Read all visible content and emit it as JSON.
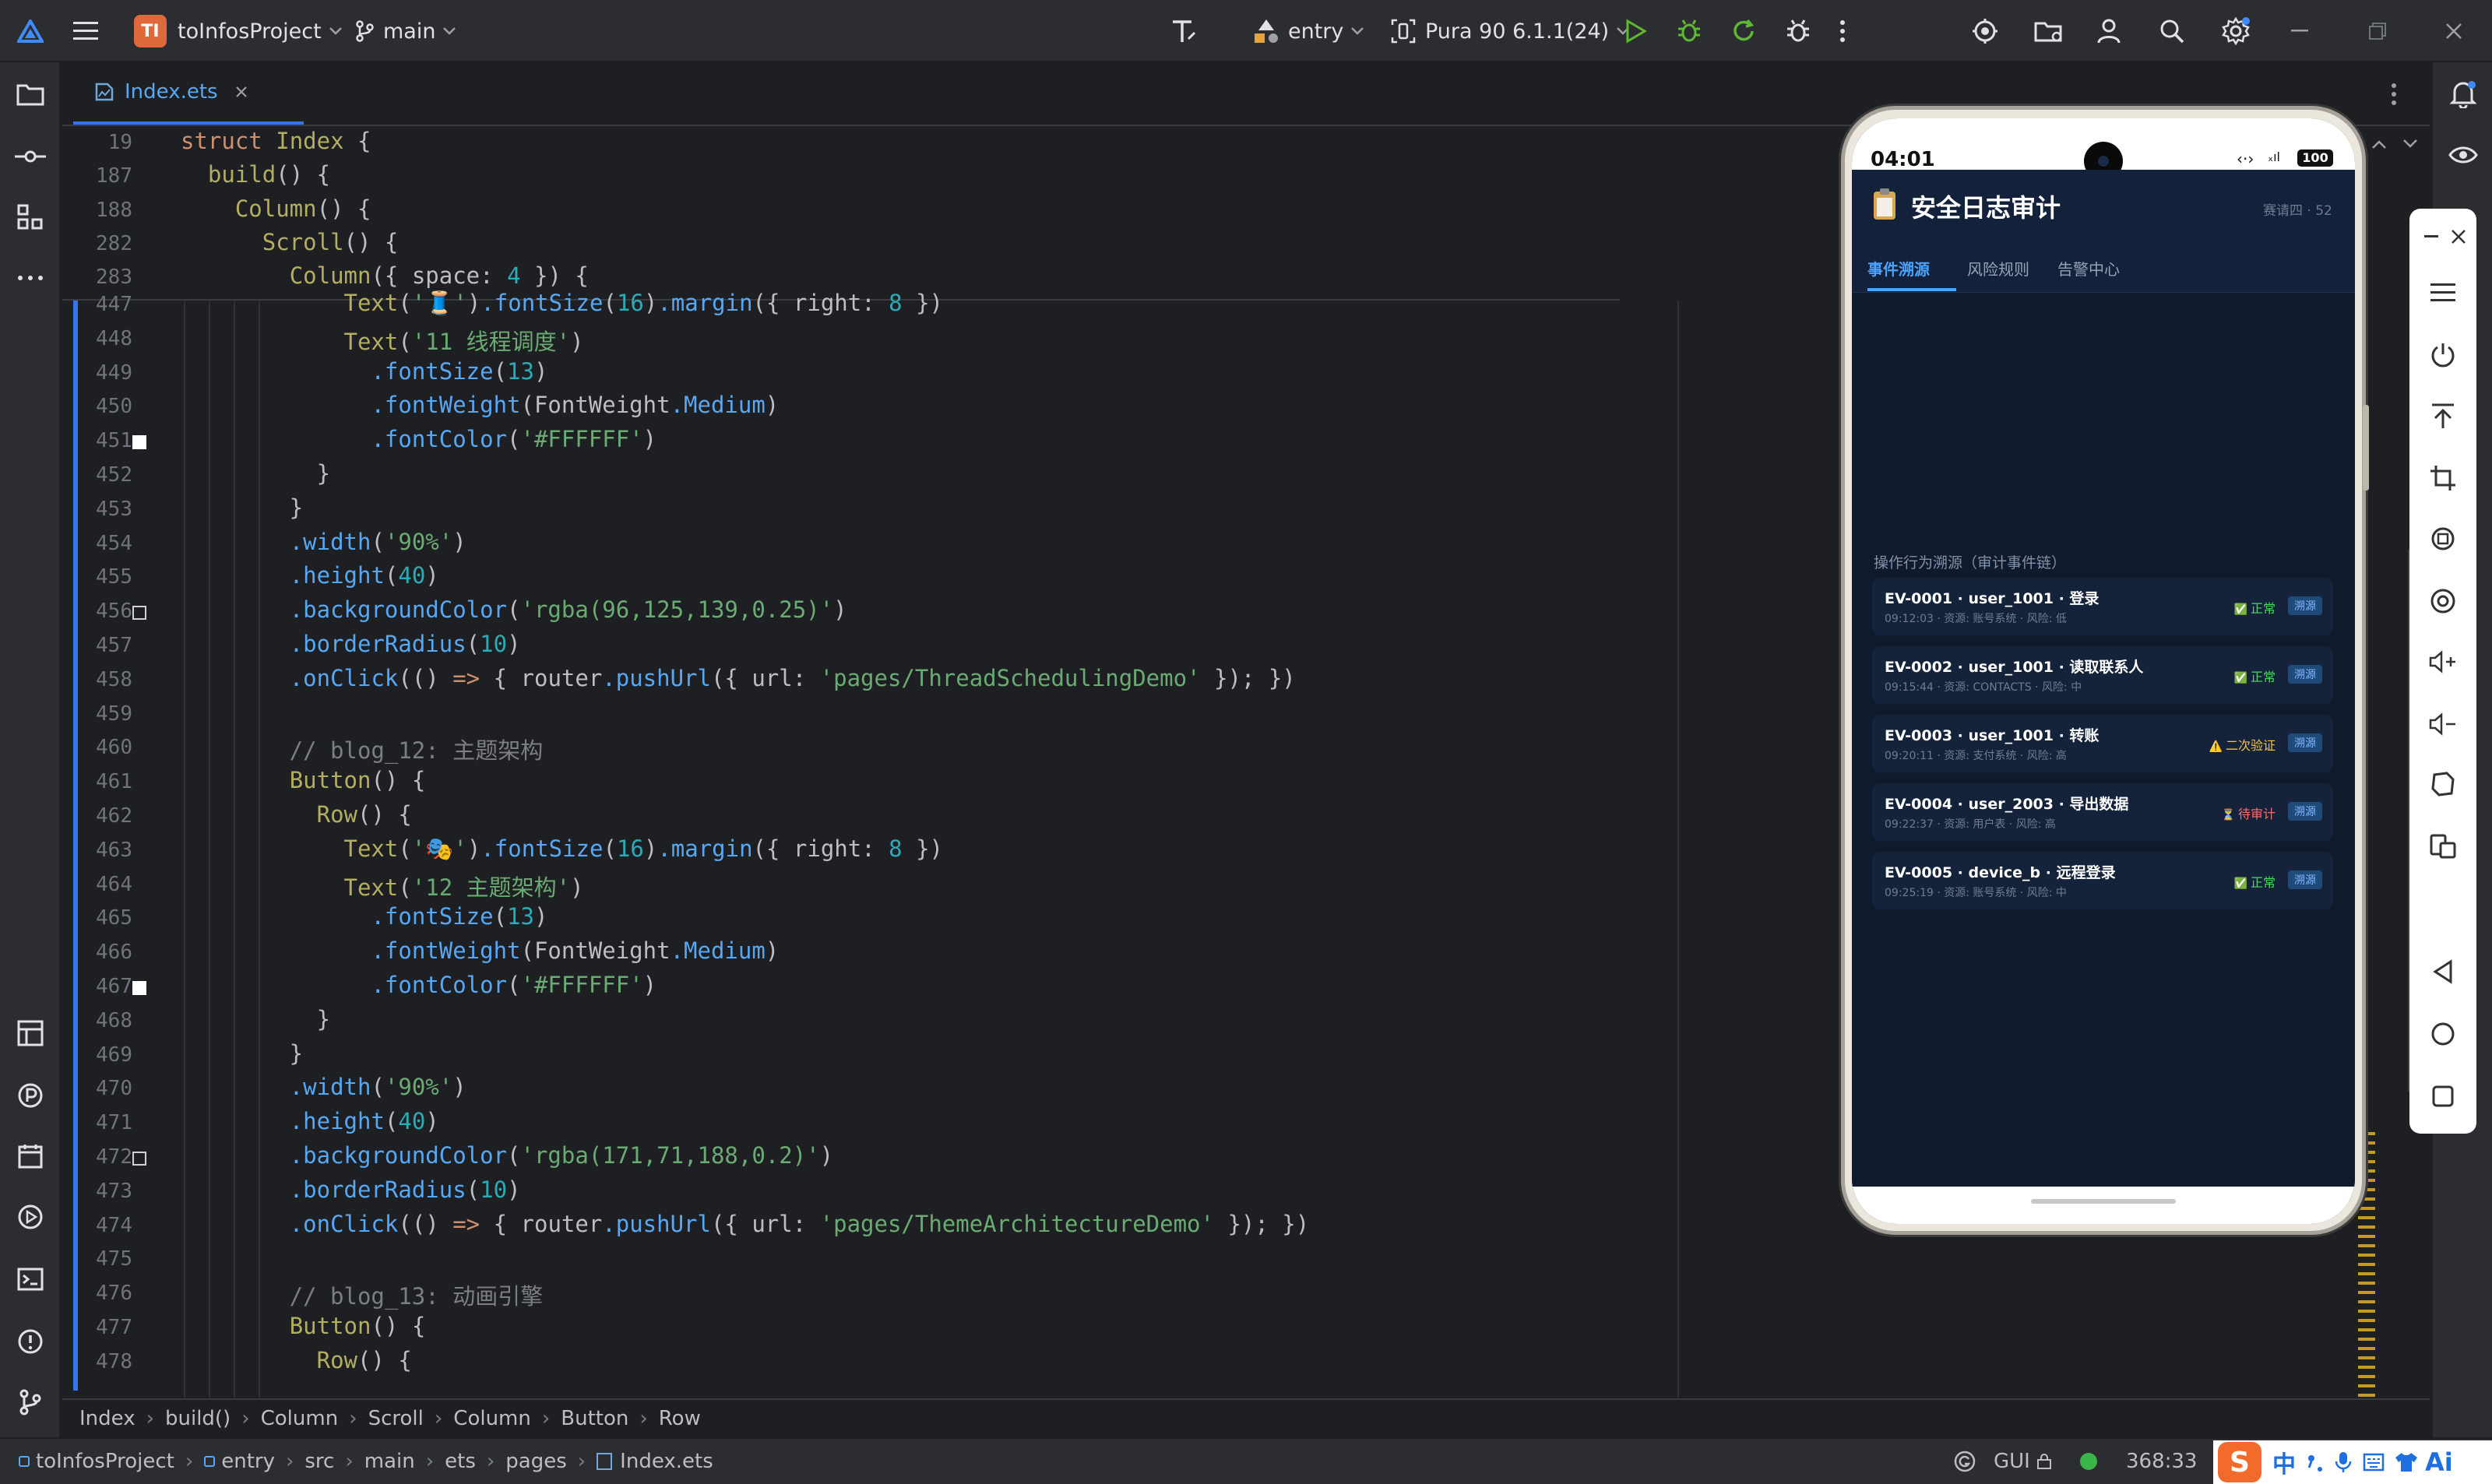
{
  "titlebar": {
    "project_badge": "TI",
    "project_name": "toInfosProject",
    "branch": "main",
    "module": "entry",
    "device": "Pura 90 6.1.1(24)"
  },
  "editor": {
    "tab_label": "Index.ets",
    "sticky": [
      {
        "n": "19",
        "code": "struct Index {"
      },
      {
        "n": "187",
        "code": "  build() {"
      },
      {
        "n": "188",
        "code": "    Column() {"
      },
      {
        "n": "282",
        "code": "      Scroll() {"
      },
      {
        "n": "283",
        "code": "        Column({ space: 4 }) {"
      }
    ],
    "lines": [
      {
        "n": "447",
        "code": "            Text('🧵').fontSize(16).margin({ right: 8 })"
      },
      {
        "n": "448",
        "code": "            Text('11 线程调度')"
      },
      {
        "n": "449",
        "code": "              .fontSize(13)"
      },
      {
        "n": "450",
        "code": "              .fontWeight(FontWeight.Medium)"
      },
      {
        "n": "451",
        "code": "              .fontColor('#FFFFFF')"
      },
      {
        "n": "452",
        "code": "          }"
      },
      {
        "n": "453",
        "code": "        }"
      },
      {
        "n": "454",
        "code": "        .width('90%')"
      },
      {
        "n": "455",
        "code": "        .height(40)"
      },
      {
        "n": "456",
        "code": "        .backgroundColor('rgba(96,125,139,0.25)')"
      },
      {
        "n": "457",
        "code": "        .borderRadius(10)"
      },
      {
        "n": "458",
        "code": "        .onClick(() => { router.pushUrl({ url: 'pages/ThreadSchedulingDemo' }); })"
      },
      {
        "n": "459",
        "code": ""
      },
      {
        "n": "460",
        "code": "        // blog_12: 主题架构"
      },
      {
        "n": "461",
        "code": "        Button() {"
      },
      {
        "n": "462",
        "code": "          Row() {"
      },
      {
        "n": "463",
        "code": "            Text('🎭').fontSize(16).margin({ right: 8 })"
      },
      {
        "n": "464",
        "code": "            Text('12 主题架构')"
      },
      {
        "n": "465",
        "code": "              .fontSize(13)"
      },
      {
        "n": "466",
        "code": "              .fontWeight(FontWeight.Medium)"
      },
      {
        "n": "467",
        "code": "              .fontColor('#FFFFFF')"
      },
      {
        "n": "468",
        "code": "          }"
      },
      {
        "n": "469",
        "code": "        }"
      },
      {
        "n": "470",
        "code": "        .width('90%')"
      },
      {
        "n": "471",
        "code": "        .height(40)"
      },
      {
        "n": "472",
        "code": "        .backgroundColor('rgba(171,71,188,0.2)')"
      },
      {
        "n": "473",
        "code": "        .borderRadius(10)"
      },
      {
        "n": "474",
        "code": "        .onClick(() => { router.pushUrl({ url: 'pages/ThemeArchitectureDemo' }); })"
      },
      {
        "n": "475",
        "code": ""
      },
      {
        "n": "476",
        "code": "        // blog_13: 动画引擎"
      },
      {
        "n": "477",
        "code": "        Button() {"
      },
      {
        "n": "478",
        "code": "          Row() {"
      }
    ]
  },
  "breadcrumb": [
    "Index",
    "build()",
    "Column",
    "Scroll",
    "Column",
    "Button",
    "Row"
  ],
  "statusbar": {
    "path": [
      "toInfosProject",
      "entry",
      "src",
      "main",
      "ets",
      "pages",
      "Index.ets"
    ],
    "gui_label": "GUI",
    "position": "368:33",
    "ime_text": "中"
  },
  "phone": {
    "time": "04:01",
    "battery": "100",
    "app_title": "安全日志审计",
    "app_icon": "clipboard-icon",
    "corner_meta": "赛请四 · 52",
    "tabs": [
      "事件溯源",
      "风险规则",
      "告警中心"
    ],
    "section_label": "操作行为溯源（审计事件链）",
    "events": [
      {
        "title": "EV-0001 · user_1001 · 登录",
        "sub": "09:12:03 · 资源: 账号系统 · 风险: 低",
        "status": "正常",
        "status_icon": "✅",
        "status_color": "#4cd964",
        "action": "溯源"
      },
      {
        "title": "EV-0002 · user_1001 · 读取联系人",
        "sub": "09:15:44 · 资源: CONTACTS · 风险: 中",
        "status": "正常",
        "status_icon": "✅",
        "status_color": "#4cd964",
        "action": "溯源"
      },
      {
        "title": "EV-0003 · user_1001 · 转账",
        "sub": "09:20:11 · 资源: 支付系统 · 风险: 高",
        "status": "二次验证",
        "status_icon": "⚠️",
        "status_color": "#f5c242",
        "action": "溯源"
      },
      {
        "title": "EV-0004 · user_2003 · 导出数据",
        "sub": "09:22:37 · 资源: 用户表 · 风险: 高",
        "status": "待审计",
        "status_icon": "⏳",
        "status_color": "#ff6b6b",
        "action": "溯源"
      },
      {
        "title": "EV-0005 · device_b · 远程登录",
        "sub": "09:25:19 · 资源: 账号系统 · 风险: 中",
        "status": "正常",
        "status_icon": "✅",
        "status_color": "#4cd964",
        "action": "溯源"
      }
    ]
  },
  "colors": {
    "accent": "#3574f0",
    "tab_active": "#4aa3ff",
    "app_bg": "#0f1b2d",
    "card_bg": "#15233a",
    "run_green": "#5fb832"
  }
}
